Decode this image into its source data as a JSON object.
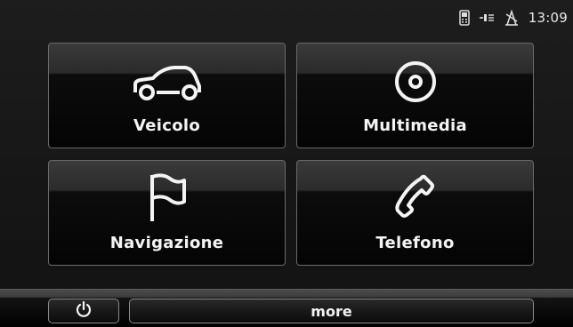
{
  "status": {
    "time": "13:09",
    "icons": [
      "phone-status-icon",
      "signal-icon",
      "gps-icon"
    ]
  },
  "menu": {
    "tiles": [
      {
        "label": "Veicolo",
        "icon": "car-icon"
      },
      {
        "label": "Multimedia",
        "icon": "disc-icon"
      },
      {
        "label": "Navigazione",
        "icon": "flag-icon"
      },
      {
        "label": "Telefono",
        "icon": "phone-icon"
      }
    ]
  },
  "bottombar": {
    "power_icon": "power-icon",
    "more_label": "more"
  }
}
